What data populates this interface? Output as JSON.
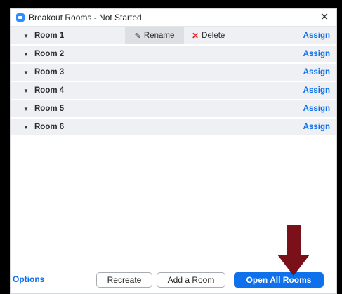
{
  "window": {
    "title": "Breakout Rooms - Not Started",
    "close_glyph": "✕"
  },
  "rooms": [
    {
      "name": "Room 1",
      "assign_label": "Assign"
    },
    {
      "name": "Room 2",
      "assign_label": "Assign"
    },
    {
      "name": "Room 3",
      "assign_label": "Assign"
    },
    {
      "name": "Room 4",
      "assign_label": "Assign"
    },
    {
      "name": "Room 5",
      "assign_label": "Assign"
    },
    {
      "name": "Room 6",
      "assign_label": "Assign"
    }
  ],
  "room_actions": {
    "rename_label": "Rename",
    "delete_label": "Delete"
  },
  "footer": {
    "options_label": "Options",
    "recreate_label": "Recreate",
    "add_room_label": "Add a Room",
    "open_all_label": "Open All Rooms"
  },
  "colors": {
    "accent": "#0e71eb",
    "row_background": "#eef0f3",
    "delete_x": "#e02828",
    "annotation_arrow": "#7a1118"
  },
  "icons": [
    "zoom-app-icon",
    "close-icon",
    "caret-down-icon",
    "pencil-icon",
    "delete-x-icon",
    "down-arrow-annotation"
  ]
}
